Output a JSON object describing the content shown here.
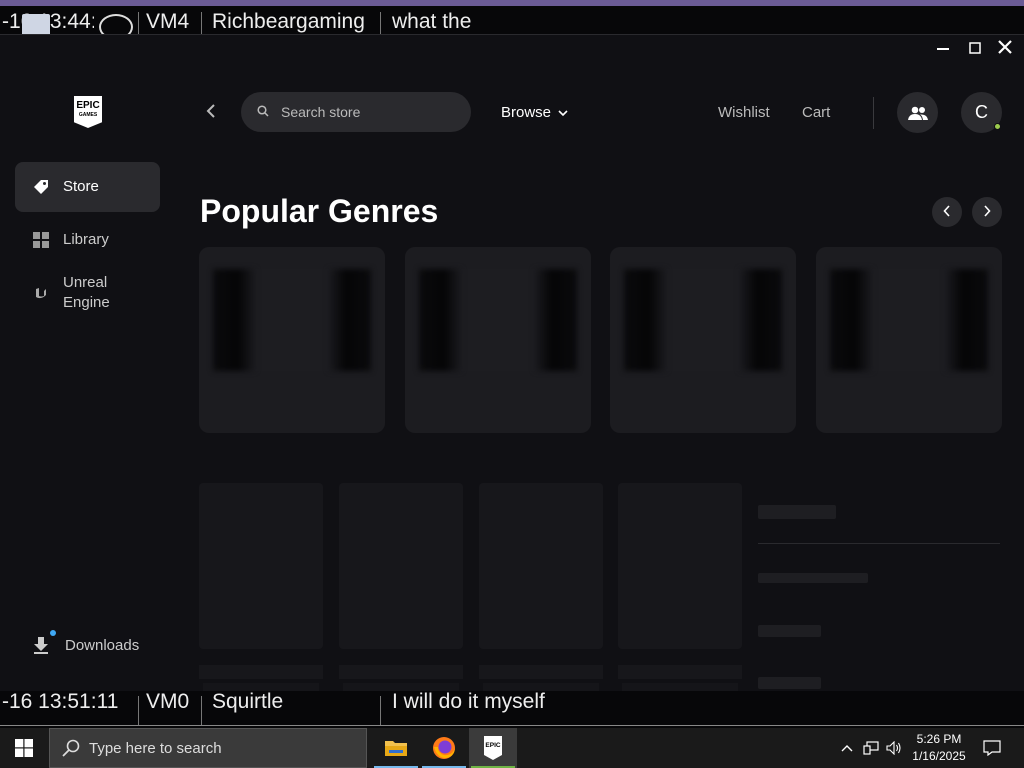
{
  "background_app": {
    "top_row": {
      "col1": "-16 13:44:",
      "col2": "VM4",
      "col3": "Richbeargaming",
      "col4": "what the"
    },
    "bottom_row": {
      "col1": "-16 13:51:11",
      "col2": "VM0",
      "col3": "Squirtle",
      "col4": "I will do it myself"
    }
  },
  "window_controls": {
    "minimize": "—",
    "maximize": "☐",
    "close": "✕"
  },
  "logo": {
    "line1": "EPIC",
    "line2": "GAMES"
  },
  "sidebar": {
    "items": [
      {
        "label": "Store",
        "icon": "tag-icon",
        "active": true
      },
      {
        "label": "Library",
        "icon": "grid-icon",
        "active": false
      },
      {
        "label": "Unreal\nEngine",
        "icon": "unreal-icon",
        "active": false
      }
    ],
    "downloads": {
      "label": "Downloads",
      "icon": "download-icon"
    }
  },
  "header": {
    "search_placeholder": "Search store",
    "browse_label": "Browse",
    "wishlist_label": "Wishlist",
    "cart_label": "Cart",
    "avatar_initial": "C"
  },
  "main": {
    "section_title": "Popular Genres"
  },
  "taskbar": {
    "search_placeholder": "Type here to search",
    "apps": [
      "file-explorer-icon",
      "firefox-icon",
      "epic-games-icon"
    ],
    "time": "5:26 PM",
    "date": "1/16/2025"
  },
  "colors": {
    "window_bg": "#101014",
    "panel": "#2a2a2e",
    "online_dot": "#9ccb4e",
    "notify_dot": "#3fa8f4",
    "taskbar_accent": "#76b9ed"
  }
}
